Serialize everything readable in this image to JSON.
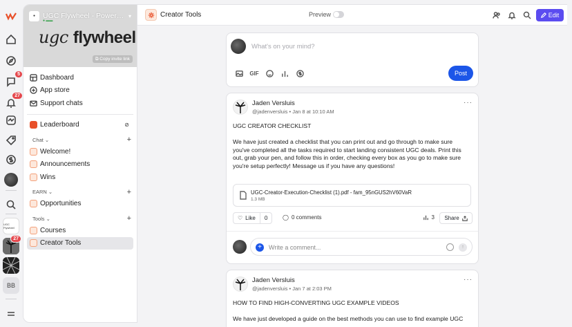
{
  "rail": {
    "notif_badge_1": "5",
    "notif_badge_2": "27",
    "tile_badge": "27",
    "tile_initials": "BB"
  },
  "workspace": {
    "title": "UGC Flywheel - Powered ...",
    "brand_italic": "ugc",
    "brand_bold": "flywheel",
    "invite_label": "Copy invite link",
    "logo_text": "UGC Flywheel"
  },
  "sidebar": {
    "top_items": [
      {
        "label": "Dashboard",
        "icon": "grid-icon"
      },
      {
        "label": "App store",
        "icon": "plus-circle-icon"
      },
      {
        "label": "Support chats",
        "icon": "mail-icon"
      }
    ],
    "leaderboard": "Leaderboard",
    "sections": {
      "chat": {
        "label": "Chat",
        "items": [
          "Welcome!",
          "Announcements",
          "Wins"
        ]
      },
      "earn": {
        "label": "EARN",
        "items": [
          "Opportunities"
        ]
      },
      "tools": {
        "label": "Tools",
        "items": [
          "Courses",
          "Creator Tools"
        ]
      }
    }
  },
  "topbar": {
    "title": "Creator Tools",
    "preview_label": "Preview",
    "edit_label": "Edit"
  },
  "composer": {
    "placeholder": "What's on your mind?",
    "gif_label": "GIF",
    "post_label": "Post"
  },
  "posts": [
    {
      "author": "Jaden Versluis",
      "handle": "@jadenversluis",
      "date": "Jan 8 at 10:10 AM",
      "heading": "UGC CREATOR CHECKLIST",
      "body": "We have just created a checklist that you can print out and go through to make sure you've completed all the tasks required to start landing consistent UGC deals. Print this out, grab your pen, and follow this in order, checking every box as you go to make sure you're setup perfectly! Message us if you have any questions!",
      "attachment_name": "UGC-Creator-Execution-Checklist (1).pdf - fam_95nGUS2hV60VaR",
      "attachment_size": "1.3 MB",
      "like_label": "Like",
      "like_count": "0",
      "comments_label": "0 comments",
      "views": "3",
      "share_label": "Share",
      "comment_placeholder": "Write a comment..."
    },
    {
      "author": "Jaden Versluis",
      "handle": "@jadenversluis",
      "date": "Jan 7 at 2:03 PM",
      "heading": "HOW TO FIND HIGH-CONVERTING UGC EXAMPLE VIDEOS",
      "body": "We have just developed a guide on the best methods you can use to find example UGC"
    }
  ],
  "colors": {
    "accent": "#5b4cf0",
    "post_button": "#1c56e8",
    "badge": "#e5484d"
  }
}
